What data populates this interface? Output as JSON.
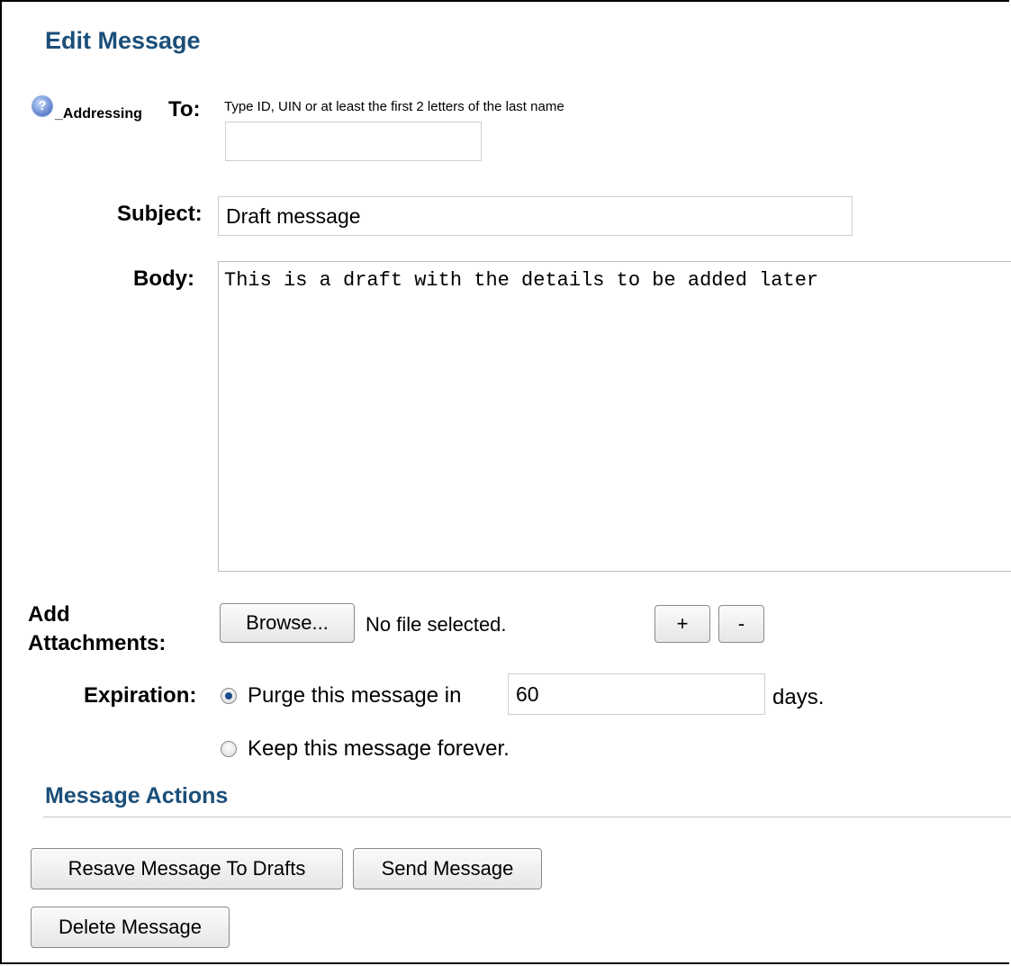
{
  "page": {
    "title": "Edit Message"
  },
  "to": {
    "help_label": "_Addressing",
    "label": "To:",
    "hint": "Type ID, UIN or at least the first 2 letters of the last name",
    "value": ""
  },
  "subject": {
    "label": "Subject:",
    "value": "Draft message"
  },
  "body": {
    "label": "Body:",
    "value": "This is a draft with the details to be added later"
  },
  "attachments": {
    "label_line1": "Add",
    "label_line2": "Attachments:",
    "browse_label": "Browse...",
    "status": "No file selected.",
    "add_label": "+",
    "remove_label": "-"
  },
  "expiration": {
    "label": "Expiration:",
    "purge_label": "Purge this message in",
    "purge_days_value": "60",
    "days_label": "days.",
    "keep_label": "Keep this message forever.",
    "selected": "purge"
  },
  "actions": {
    "heading": "Message Actions",
    "resave_label": "Resave Message To Drafts",
    "send_label": "Send Message",
    "delete_label": "Delete Message"
  },
  "icons": {
    "help": "help-icon"
  },
  "colors": {
    "heading": "#1b4f7a",
    "radio_selected": "#1c4e8c"
  }
}
